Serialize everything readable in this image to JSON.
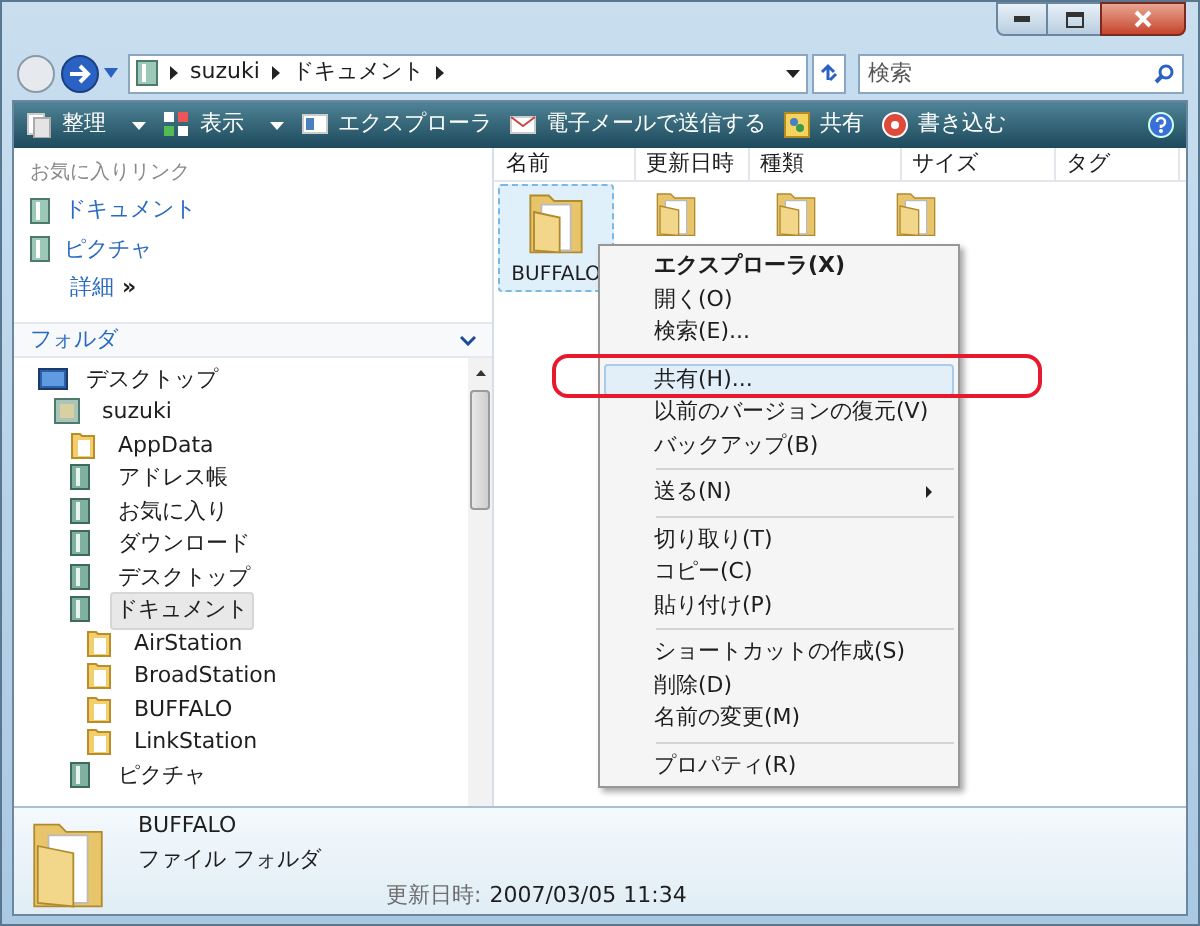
{
  "address": {
    "crumbs": [
      "suzuki",
      "ドキュメント"
    ]
  },
  "search": {
    "placeholder": "検索"
  },
  "toolbar": [
    {
      "label": "整理",
      "dropdown": true
    },
    {
      "label": "表示",
      "dropdown": true
    },
    {
      "label": "エクスプローラ",
      "dropdown": false
    },
    {
      "label": "電子メールで送信する",
      "dropdown": false
    },
    {
      "label": "共有",
      "dropdown": false
    },
    {
      "label": "書き込む",
      "dropdown": false
    }
  ],
  "favorite_links": {
    "title": "お気に入りリンク",
    "items": [
      {
        "label": "ドキュメント"
      },
      {
        "label": "ピクチャ"
      }
    ],
    "more": {
      "label": "詳細",
      "glyph": "»"
    }
  },
  "folders": {
    "title": "フォルダ",
    "tree": [
      {
        "label": "デスクトップ",
        "kind": "desktop",
        "selected": false,
        "children": [
          {
            "label": "suzuki",
            "kind": "user",
            "selected": false,
            "children": [
              {
                "label": "AppData",
                "kind": "folder",
                "selected": false
              },
              {
                "label": "アドレス帳",
                "kind": "special",
                "selected": false
              },
              {
                "label": "お気に入り",
                "kind": "special",
                "selected": false
              },
              {
                "label": "ダウンロード",
                "kind": "special",
                "selected": false
              },
              {
                "label": "デスクトップ",
                "kind": "special",
                "selected": false
              },
              {
                "label": "ドキュメント",
                "kind": "special",
                "selected": true,
                "children": [
                  {
                    "label": "AirStation",
                    "kind": "folder",
                    "selected": false
                  },
                  {
                    "label": "BroadStation",
                    "kind": "folder",
                    "selected": false
                  },
                  {
                    "label": "BUFFALO",
                    "kind": "folder",
                    "selected": false
                  },
                  {
                    "label": "LinkStation",
                    "kind": "folder",
                    "selected": false
                  }
                ]
              },
              {
                "label": "ピクチャ",
                "kind": "special",
                "selected": false
              }
            ]
          }
        ]
      }
    ]
  },
  "file_list": {
    "columns": [
      "名前",
      "更新日時",
      "種類",
      "サイズ",
      "タグ"
    ],
    "items": [
      {
        "name": "BUFFALO",
        "selected": true
      },
      {
        "selected": false
      },
      {
        "selected": false
      },
      {
        "selected": false
      }
    ]
  },
  "context_menu": [
    {
      "kind": "item",
      "label": "エクスプローラ(X)",
      "default": true,
      "selected": false,
      "circled": false,
      "submenu": false
    },
    {
      "kind": "item",
      "label": "開く(O)",
      "default": false,
      "selected": false,
      "circled": false,
      "submenu": false
    },
    {
      "kind": "item",
      "label": "検索(E)...",
      "default": false,
      "selected": false,
      "circled": false,
      "submenu": false
    },
    {
      "kind": "separator"
    },
    {
      "kind": "item",
      "label": "共有(H)...",
      "default": false,
      "selected": true,
      "circled": true,
      "submenu": false
    },
    {
      "kind": "item",
      "label": "以前のバージョンの復元(V)",
      "default": false,
      "selected": false,
      "circled": false,
      "submenu": false
    },
    {
      "kind": "item",
      "label": "バックアップ(B)",
      "default": false,
      "selected": false,
      "circled": false,
      "submenu": false
    },
    {
      "kind": "separator"
    },
    {
      "kind": "item",
      "label": "送る(N)",
      "default": false,
      "selected": false,
      "circled": false,
      "submenu": true
    },
    {
      "kind": "separator"
    },
    {
      "kind": "item",
      "label": "切り取り(T)",
      "default": false,
      "selected": false,
      "circled": false,
      "submenu": false
    },
    {
      "kind": "item",
      "label": "コピー(C)",
      "default": false,
      "selected": false,
      "circled": false,
      "submenu": false
    },
    {
      "kind": "item",
      "label": "貼り付け(P)",
      "default": false,
      "selected": false,
      "circled": false,
      "submenu": false
    },
    {
      "kind": "separator"
    },
    {
      "kind": "item",
      "label": "ショートカットの作成(S)",
      "default": false,
      "selected": false,
      "circled": false,
      "submenu": false
    },
    {
      "kind": "item",
      "label": "削除(D)",
      "default": false,
      "selected": false,
      "circled": false,
      "submenu": false
    },
    {
      "kind": "item",
      "label": "名前の変更(M)",
      "default": false,
      "selected": false,
      "circled": false,
      "submenu": false
    },
    {
      "kind": "separator"
    },
    {
      "kind": "item",
      "label": "プロパティ(R)",
      "default": false,
      "selected": false,
      "circled": false,
      "submenu": false
    }
  ],
  "details": {
    "name": "BUFFALO",
    "type": "ファイル フォルダ",
    "date_label": "更新日時:",
    "date_value": "2007/03/05 11:34"
  }
}
